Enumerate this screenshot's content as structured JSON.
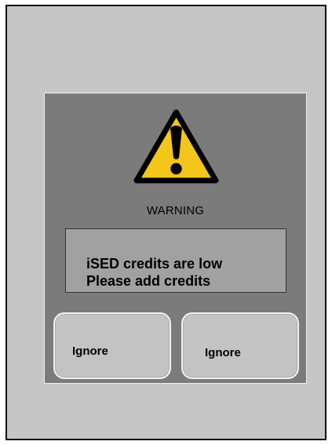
{
  "dialog": {
    "icon": {
      "name": "warning-icon",
      "fill_color": "#f4c51a",
      "outline_color": "#000000"
    },
    "heading": "WARNING",
    "message": {
      "lines": [
        "iSED credits are low",
        "Please add credits"
      ]
    },
    "buttons": [
      {
        "label": "Ignore"
      },
      {
        "label": "Ignore"
      }
    ]
  },
  "colors": {
    "device_background": "#c6c6c6",
    "dialog_background": "#7b7b7b",
    "message_background": "#a1a1a1",
    "button_background": "#c3c3c3",
    "device_border": "#111111"
  }
}
